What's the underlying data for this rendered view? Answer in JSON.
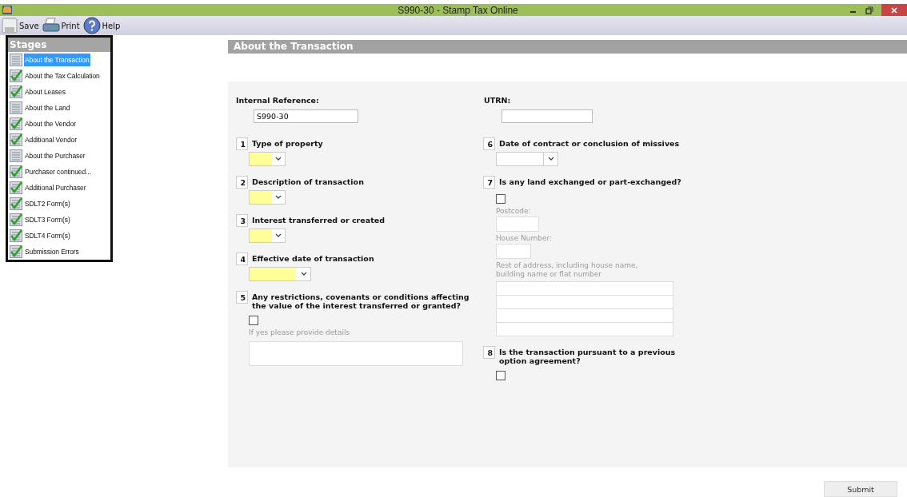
{
  "window": {
    "title": "S990-30 - Stamp Tax Online"
  },
  "toolbar": [
    {
      "label": "Save",
      "kind": "save"
    },
    {
      "label": "Print",
      "kind": "print"
    },
    {
      "label": "Help",
      "kind": "help"
    }
  ],
  "stages": {
    "title": "Stages",
    "items": [
      {
        "label": "About the Transaction",
        "completed": false,
        "selected": true
      },
      {
        "label": "About the Tax Calculation",
        "completed": true,
        "selected": false
      },
      {
        "label": "About Leases",
        "completed": true,
        "selected": false
      },
      {
        "label": "About the Land",
        "completed": false,
        "selected": false
      },
      {
        "label": "About the Vendor",
        "completed": true,
        "selected": false
      },
      {
        "label": "Additional Vendor",
        "completed": true,
        "selected": false
      },
      {
        "label": "About the Purchaser",
        "completed": false,
        "selected": false
      },
      {
        "label": "Purchaser continued...",
        "completed": true,
        "selected": false
      },
      {
        "label": "Additional Purchaser",
        "completed": true,
        "selected": false
      },
      {
        "label": "SDLT2 Form(s)",
        "completed": true,
        "selected": false
      },
      {
        "label": "SDLT3 Form(s)",
        "completed": true,
        "selected": false
      },
      {
        "label": "SDLT4 Form(s)",
        "completed": true,
        "selected": false
      },
      {
        "label": "Submission Errors",
        "completed": true,
        "selected": false
      }
    ]
  },
  "section": {
    "title": "About the Transaction"
  },
  "internal_reference": {
    "label": "Internal Reference:",
    "value": "S990-30"
  },
  "utrn": {
    "label": "UTRN:"
  },
  "left_questions": [
    {
      "number": "1",
      "label": "Type of property",
      "kind": "dropdown",
      "required": true
    },
    {
      "number": "2",
      "label": "Description of transaction",
      "kind": "dropdown",
      "required": true
    },
    {
      "number": "3",
      "label": "Interest transferred or created",
      "kind": "dropdown",
      "required": true
    },
    {
      "number": "4",
      "label": "Effective date of transaction",
      "kind": "date",
      "required": true
    },
    {
      "number": "5",
      "label": "Any restrictions, covenants or conditions affecting the value of the interest transferred or granted?",
      "kind": "details",
      "checked": false,
      "details_label": "If yes please provide details"
    }
  ],
  "right_questions": [
    {
      "number": "6",
      "label": "Date of contract or conclusion of missives",
      "kind": "date",
      "required": false
    },
    {
      "number": "7",
      "label": "Is any land exchanged or part-exchanged?",
      "kind": "address",
      "checked": false,
      "postcode_label": "Postcode:",
      "house_number_label": "House Number:",
      "rest_label": "Rest of address, including house name, building name or flat number"
    },
    {
      "number": "8",
      "label": "Is the transaction pursuant to a previous option agreement?",
      "kind": "checkbox",
      "checked": false
    }
  ],
  "submit": {
    "label": "Submit"
  }
}
